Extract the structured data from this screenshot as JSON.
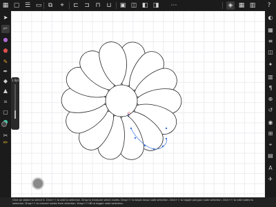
{
  "app": {
    "accent_color": "#5b8cff",
    "selection_color": "#3a6fd8"
  },
  "toolbar": {
    "icons": [
      "grid-menu-icon",
      "document-icon",
      "menu-icon",
      "undo-history-icon",
      "transform-icon",
      "snap-icon",
      "align-left-icon",
      "align-center-icon",
      "align-right-icon",
      "distribute-icon",
      "boolean-add-icon",
      "boolean-subtract-icon",
      "boolean-intersect-icon",
      "arrange-icon",
      "more-icon",
      "persona-designer-icon",
      "persona-pixel-icon",
      "persona-export-icon",
      "help-icon"
    ]
  },
  "left_tools": [
    "move-tool-icon",
    "node-tool-icon",
    "color-picker-icon",
    "brush-tool-icon",
    "pencil-tool-icon",
    "pen-tool-icon",
    "fill-tool-icon",
    "eraser-tool-icon",
    "crop-tool-icon",
    "shape-tool-icon",
    "text-tool-icon",
    "vector-brush-icon",
    "zoom-tool-icon"
  ],
  "right_panel": [
    "color-panel-icon",
    "swatches-icon",
    "stroke-icon",
    "layers-icon",
    "effects-icon",
    "styles-icon",
    "text-styles-icon",
    "transform-panel-icon",
    "history-icon",
    "navigator-icon",
    "constraints-icon",
    "snapping-icon",
    "assets-icon",
    "character-icon",
    "paragraph-icon"
  ],
  "slider": {
    "label": "1.0pt",
    "fill_fraction": 0.25
  },
  "status_bar": {
    "text": "Click an object to select it. Click+⇧ to add to selection. Drag to marquee select nodes. Drag+⇧ to begin lasso node selection. Click+⇧ to toggle polygon node selection. Click+⇧ to add nodes to selection. Drag+⇧ to remove nodes from selection. Drag+⇧+⌘ to toggle node selection."
  }
}
